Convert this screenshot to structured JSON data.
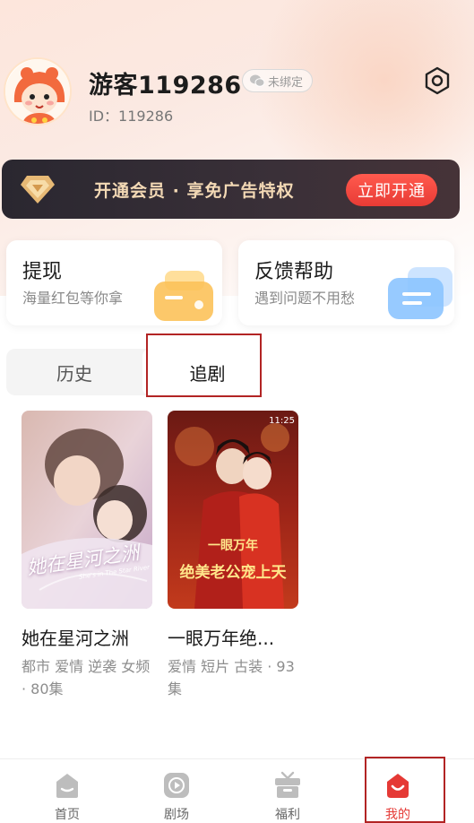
{
  "profile": {
    "username": "游客119286",
    "wechat_status": "未绑定",
    "user_id": "ID：119286"
  },
  "vip_banner": {
    "text": "开通会员 · 享免广告特权",
    "button_label": "立即开通"
  },
  "cards": [
    {
      "title": "提现",
      "subtitle": "海量红包等你拿"
    },
    {
      "title": "反馈帮助",
      "subtitle": "遇到问题不用愁"
    }
  ],
  "tabs": [
    {
      "label": "历史",
      "active": false
    },
    {
      "label": "追剧",
      "active": true
    }
  ],
  "dramas": [
    {
      "title": "她在星河之洲",
      "tags": "都市 爱情 逆袭 女频 · 80集",
      "poster_caption": "她在星河之洲",
      "poster_sub": "She's in The Star River"
    },
    {
      "title": "一眼万年绝...",
      "tags": "爱情 短片 古装 · 93集",
      "poster_caption": "一眼万年",
      "poster_caption2": "绝美老公宠上天",
      "poster_time": "11:25"
    }
  ],
  "nav": {
    "items": [
      {
        "label": "首页",
        "icon": "home-icon"
      },
      {
        "label": "剧场",
        "icon": "play-icon"
      },
      {
        "label": "福利",
        "icon": "gift-icon"
      },
      {
        "label": "我的",
        "icon": "mine-icon",
        "active": true
      }
    ]
  },
  "colors": {
    "accent": "#e53935",
    "vip_gold": "#f3d9b5",
    "vip_bg": "#2a2730"
  }
}
